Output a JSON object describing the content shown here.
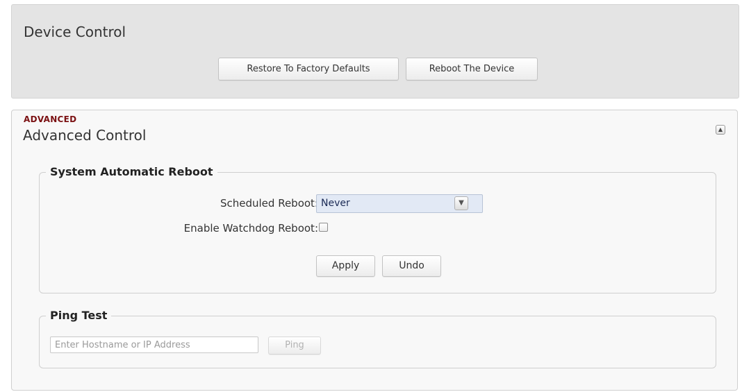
{
  "device_control": {
    "title": "Device Control",
    "restore_button": "Restore To Factory Defaults",
    "reboot_button": "Reboot The Device"
  },
  "advanced": {
    "tag": "ADVANCED",
    "title": "Advanced Control",
    "collapse_icon": "chevron-up-icon",
    "auto_reboot": {
      "legend": "System Automatic Reboot",
      "scheduled_label": "Scheduled Reboot:",
      "scheduled_value": "Never",
      "watchdog_label": "Enable Watchdog Reboot:",
      "watchdog_checked": false,
      "apply_button": "Apply",
      "undo_button": "Undo"
    },
    "ping": {
      "legend": "Ping Test",
      "placeholder": "Enter Hostname or IP Address",
      "ping_button": "Ping"
    }
  },
  "colors": {
    "accent_tag": "#7b1113",
    "select_bg": "#e2e9f5"
  }
}
